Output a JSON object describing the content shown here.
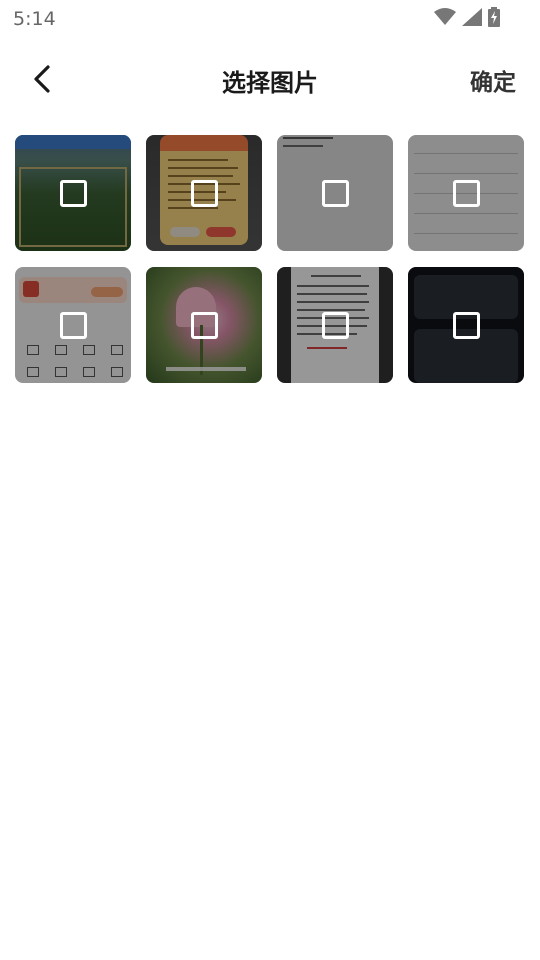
{
  "status_bar": {
    "time": "5:14"
  },
  "header": {
    "title": "选择图片",
    "confirm_label": "确定"
  },
  "icons": {
    "back": "chevron-left-icon",
    "wifi": "wifi-icon",
    "signal": "signal-icon",
    "battery": "battery-charging-icon"
  },
  "images": [
    {
      "checked": false,
      "thumb": "green-window"
    },
    {
      "checked": false,
      "thumb": "yellow-dialog"
    },
    {
      "checked": false,
      "thumb": "gray-page"
    },
    {
      "checked": false,
      "thumb": "settings-list"
    },
    {
      "checked": false,
      "thumb": "app-banner"
    },
    {
      "checked": false,
      "thumb": "pink-flower"
    },
    {
      "checked": false,
      "thumb": "document-text"
    },
    {
      "checked": false,
      "thumb": "dark-settings"
    }
  ]
}
